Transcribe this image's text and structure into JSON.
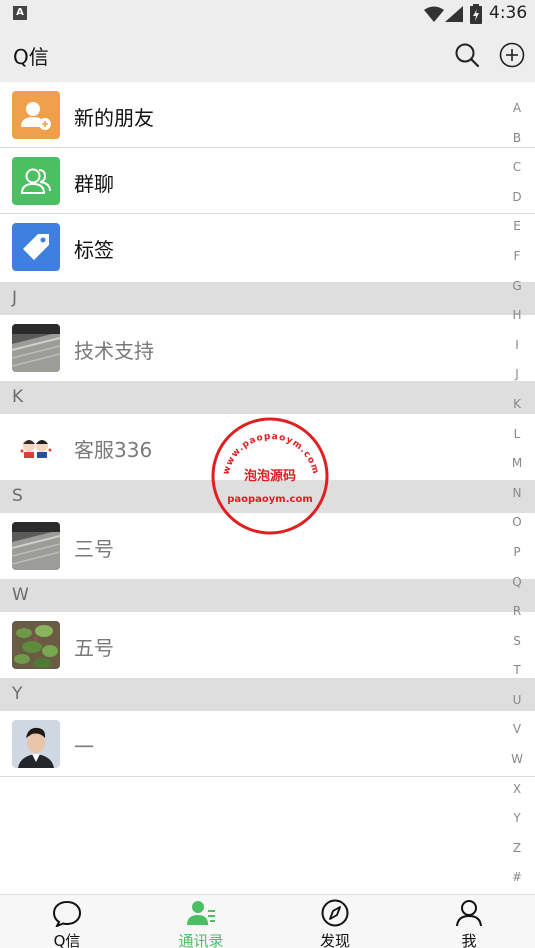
{
  "status_bar": {
    "time": "4:36",
    "notification_icon": "A"
  },
  "header": {
    "title": "Q信",
    "search_icon": "search-icon",
    "add_icon": "plus-circle-icon"
  },
  "functions": [
    {
      "label": "新的朋友",
      "icon": "add-friend-icon",
      "color": "#f0a04a"
    },
    {
      "label": "群聊",
      "icon": "group-chat-icon",
      "color": "#4cbf62"
    },
    {
      "label": "标签",
      "icon": "tag-icon",
      "color": "#3f7fe0"
    }
  ],
  "sections": [
    {
      "letter": "J",
      "contacts": [
        {
          "name": "技术支持",
          "avatar": "keyboard-photo"
        }
      ]
    },
    {
      "letter": "K",
      "contacts": [
        {
          "name": "客服336",
          "avatar": "cartoon-couple"
        }
      ]
    },
    {
      "letter": "S",
      "contacts": [
        {
          "name": "三号",
          "avatar": "keyboard-photo"
        }
      ]
    },
    {
      "letter": "W",
      "contacts": [
        {
          "name": "五号",
          "avatar": "plant-photo"
        }
      ]
    },
    {
      "letter": "Y",
      "contacts": [
        {
          "name": "一",
          "avatar": "man-portrait"
        }
      ]
    }
  ],
  "index_letters": [
    "A",
    "B",
    "C",
    "D",
    "E",
    "F",
    "G",
    "H",
    "I",
    "J",
    "K",
    "L",
    "M",
    "N",
    "O",
    "P",
    "Q",
    "R",
    "S",
    "T",
    "U",
    "V",
    "W",
    "X",
    "Y",
    "Z",
    "#"
  ],
  "watermark": {
    "top_text": "www.paopaoym.com",
    "center_text": "泡泡源码",
    "bottom_text": "paopaoym.com"
  },
  "bottom_nav": [
    {
      "label": "Q信",
      "icon": "chat-bubble-icon",
      "active": false
    },
    {
      "label": "通讯录",
      "icon": "contacts-icon",
      "active": true
    },
    {
      "label": "发现",
      "icon": "compass-icon",
      "active": false
    },
    {
      "label": "我",
      "icon": "person-icon",
      "active": false
    }
  ],
  "colors": {
    "accent": "#4cbf62",
    "stamp": "#e02020"
  }
}
